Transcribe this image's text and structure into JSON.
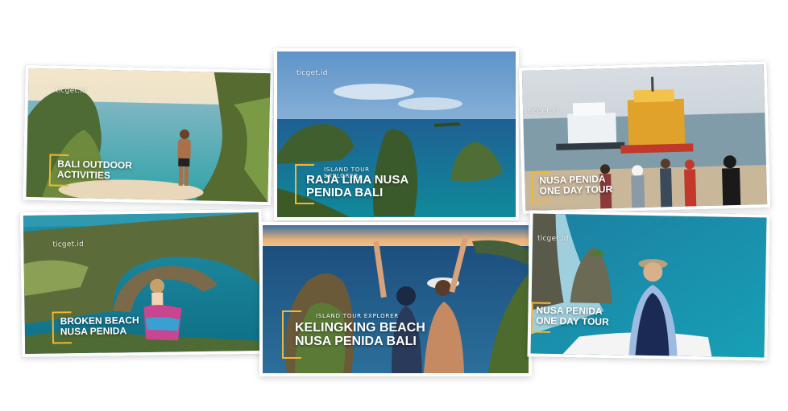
{
  "brand_watermark": "ticget.id",
  "colors": {
    "accent_bracket": "#f2b632",
    "background": "#ffffff"
  },
  "cards": [
    {
      "id": "bali-outdoor",
      "title": "Bali Outdoor\nActivities",
      "watermark": "ticget.id"
    },
    {
      "id": "raja-lima",
      "subtitle": "Island Tour Explorer",
      "title": "Raja Lima Nusa\nPenida Bali",
      "watermark": "ticget.id"
    },
    {
      "id": "nusa-penida-day-1",
      "title": "Nusa Penida\nOne Day Tour",
      "watermark": "ticget.id"
    },
    {
      "id": "broken-beach",
      "title": "Broken Beach\nNusa Penida",
      "watermark": "ticget.id"
    },
    {
      "id": "kelingking",
      "subtitle": "Island Tour Explorer",
      "title": "Kelingking Beach\nNusa Penida Bali",
      "watermark": "ticget.id"
    },
    {
      "id": "nusa-penida-day-2",
      "title": "Nusa Penida\nOne Day Tour",
      "watermark": "ticget.id"
    }
  ]
}
